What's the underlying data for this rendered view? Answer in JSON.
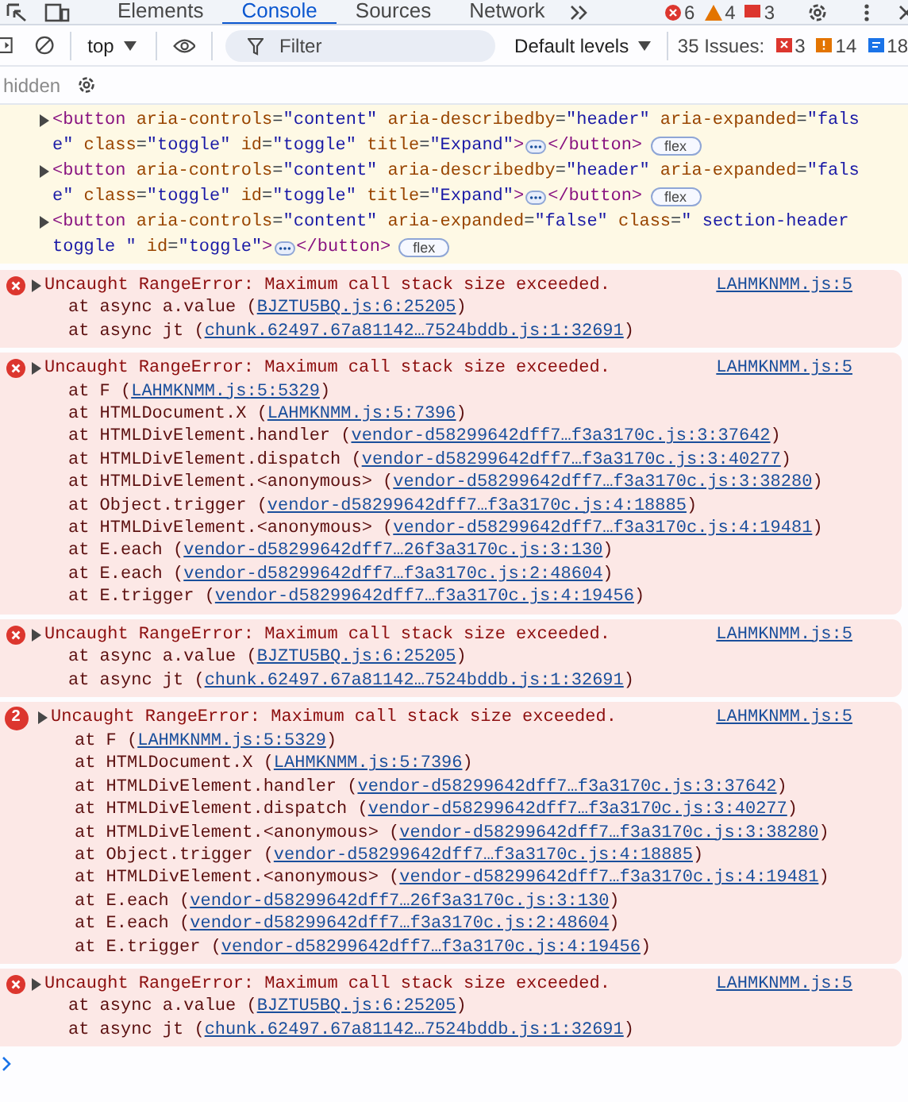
{
  "tabs": [
    {
      "label": "Elements",
      "selected": false
    },
    {
      "label": "Console",
      "selected": true
    },
    {
      "label": "Sources",
      "selected": false
    },
    {
      "label": "Network",
      "selected": false
    }
  ],
  "tab_counts": {
    "errors": "6",
    "warnings": "4",
    "issues": "3"
  },
  "toolbar": {
    "context": "top",
    "filter": {
      "placeholder": "Filter"
    },
    "levels": "Default levels",
    "issues_label": "35 Issues:",
    "issue_counts": [
      {
        "kind": "error",
        "count": "3"
      },
      {
        "kind": "warning",
        "count": "14"
      },
      {
        "kind": "info",
        "count": "18"
      }
    ]
  },
  "hidden_label": "hidden",
  "nodes": [
    {
      "expanded": false,
      "badge": "flex",
      "lines": [
        [
          {
            "kind": "tag",
            "text": "<button"
          },
          {
            "kind": "attr",
            "text": " aria-controls"
          },
          {
            "kind": "plain",
            "text": "="
          },
          {
            "kind": "value",
            "text": "\"content\""
          },
          {
            "kind": "attr",
            "text": " aria-describedby"
          },
          {
            "kind": "plain",
            "text": "="
          },
          {
            "kind": "value",
            "text": "\"header\""
          },
          {
            "kind": "attr",
            "text": " aria-expanded"
          },
          {
            "kind": "plain",
            "text": "="
          },
          {
            "kind": "value",
            "text": "\"fals"
          }
        ],
        [
          {
            "kind": "value",
            "text": "e\""
          },
          {
            "kind": "attr",
            "text": " class"
          },
          {
            "kind": "plain",
            "text": "="
          },
          {
            "kind": "value",
            "text": "\"toggle\""
          },
          {
            "kind": "attr",
            "text": " id"
          },
          {
            "kind": "plain",
            "text": "="
          },
          {
            "kind": "value",
            "text": "\"toggle\""
          },
          {
            "kind": "attr",
            "text": " title"
          },
          {
            "kind": "plain",
            "text": "="
          },
          {
            "kind": "value",
            "text": "\"Expand\""
          },
          {
            "kind": "tag",
            "text": ">"
          },
          {
            "kind": "ellipsis"
          },
          {
            "kind": "tag",
            "text": "</button>"
          }
        ]
      ]
    },
    {
      "expanded": false,
      "badge": "flex",
      "lines": [
        [
          {
            "kind": "tag",
            "text": "<button"
          },
          {
            "kind": "attr",
            "text": " aria-controls"
          },
          {
            "kind": "plain",
            "text": "="
          },
          {
            "kind": "value",
            "text": "\"content\""
          },
          {
            "kind": "attr",
            "text": " aria-describedby"
          },
          {
            "kind": "plain",
            "text": "="
          },
          {
            "kind": "value",
            "text": "\"header\""
          },
          {
            "kind": "attr",
            "text": " aria-expanded"
          },
          {
            "kind": "plain",
            "text": "="
          },
          {
            "kind": "value",
            "text": "\"fals"
          }
        ],
        [
          {
            "kind": "value",
            "text": "e\""
          },
          {
            "kind": "attr",
            "text": " class"
          },
          {
            "kind": "plain",
            "text": "="
          },
          {
            "kind": "value",
            "text": "\"toggle\""
          },
          {
            "kind": "attr",
            "text": " id"
          },
          {
            "kind": "plain",
            "text": "="
          },
          {
            "kind": "value",
            "text": "\"toggle\""
          },
          {
            "kind": "attr",
            "text": " title"
          },
          {
            "kind": "plain",
            "text": "="
          },
          {
            "kind": "value",
            "text": "\"Expand\""
          },
          {
            "kind": "tag",
            "text": ">"
          },
          {
            "kind": "ellipsis"
          },
          {
            "kind": "tag",
            "text": "</button>"
          }
        ]
      ]
    },
    {
      "expanded": false,
      "badge": "flex",
      "lines": [
        [
          {
            "kind": "tag",
            "text": "<button"
          },
          {
            "kind": "attr",
            "text": " aria-controls"
          },
          {
            "kind": "plain",
            "text": "="
          },
          {
            "kind": "value",
            "text": "\"content\""
          },
          {
            "kind": "attr",
            "text": " aria-expanded"
          },
          {
            "kind": "plain",
            "text": "="
          },
          {
            "kind": "value",
            "text": "\"false\""
          },
          {
            "kind": "attr",
            "text": " class"
          },
          {
            "kind": "plain",
            "text": "="
          },
          {
            "kind": "value",
            "text": "\" section-header"
          }
        ],
        [
          {
            "kind": "value",
            "text": "toggle \""
          },
          {
            "kind": "attr",
            "text": " id"
          },
          {
            "kind": "plain",
            "text": "="
          },
          {
            "kind": "value",
            "text": "\"toggle\""
          },
          {
            "kind": "tag",
            "text": ">"
          },
          {
            "kind": "ellipsis"
          },
          {
            "kind": "tag",
            "text": "</button>"
          }
        ]
      ]
    }
  ],
  "errors": [
    {
      "expanded": false,
      "message": "Uncaught RangeError: Maximum call stack size exceeded.",
      "source": "LAHMKNMM.js:5",
      "frames": [
        {
          "text": "at async a.value (",
          "link": "BJZTU5BQ.js:6:25205",
          "after": ")"
        },
        {
          "text": "at async jt (",
          "link": "chunk.62497.67a81142…7524bddb.js:1:32691",
          "after": ")"
        }
      ]
    },
    {
      "expanded": false,
      "message": "Uncaught RangeError: Maximum call stack size exceeded.",
      "source": "LAHMKNMM.js:5",
      "frames": [
        {
          "text": "at F (",
          "link": "LAHMKNMM.js:5:5329",
          "after": ")"
        },
        {
          "text": "at HTMLDocument.X (",
          "link": "LAHMKNMM.js:5:7396",
          "after": ")"
        },
        {
          "text": "at HTMLDivElement.handler (",
          "link": "vendor-d58299642dff7…f3a3170c.js:3:37642",
          "after": ")"
        },
        {
          "text": "at HTMLDivElement.dispatch (",
          "link": "vendor-d58299642dff7…f3a3170c.js:3:40277",
          "after": ")"
        },
        {
          "text": "at HTMLDivElement.<anonymous> (",
          "link": "vendor-d58299642dff7…f3a3170c.js:3:38280",
          "after": ")"
        },
        {
          "text": "at Object.trigger (",
          "link": "vendor-d58299642dff7…f3a3170c.js:4:18885",
          "after": ")"
        },
        {
          "text": "at HTMLDivElement.<anonymous> (",
          "link": "vendor-d58299642dff7…f3a3170c.js:4:19481",
          "after": ")"
        },
        {
          "text": "at E.each (",
          "link": "vendor-d58299642dff7…26f3a3170c.js:3:130",
          "after": ")"
        },
        {
          "text": "at E.each (",
          "link": "vendor-d58299642dff7…f3a3170c.js:2:48604",
          "after": ")"
        },
        {
          "text": "at E.trigger (",
          "link": "vendor-d58299642dff7…f3a3170c.js:4:19456",
          "after": ")"
        }
      ]
    },
    {
      "expanded": false,
      "message": "Uncaught RangeError: Maximum call stack size exceeded.",
      "source": "LAHMKNMM.js:5",
      "frames": [
        {
          "text": "at async a.value (",
          "link": "BJZTU5BQ.js:6:25205",
          "after": ")"
        },
        {
          "text": "at async jt (",
          "link": "chunk.62497.67a81142…7524bddb.js:1:32691",
          "after": ")"
        }
      ]
    },
    {
      "expanded": false,
      "count": "2",
      "message": "Uncaught RangeError: Maximum call stack size exceeded.",
      "source": "LAHMKNMM.js:5",
      "frames": [
        {
          "text": "at F (",
          "link": "LAHMKNMM.js:5:5329",
          "after": ")"
        },
        {
          "text": "at HTMLDocument.X (",
          "link": "LAHMKNMM.js:5:7396",
          "after": ")"
        },
        {
          "text": "at HTMLDivElement.handler (",
          "link": "vendor-d58299642dff7…f3a3170c.js:3:37642",
          "after": ")"
        },
        {
          "text": "at HTMLDivElement.dispatch (",
          "link": "vendor-d58299642dff7…f3a3170c.js:3:40277",
          "after": ")"
        },
        {
          "text": "at HTMLDivElement.<anonymous> (",
          "link": "vendor-d58299642dff7…f3a3170c.js:3:38280",
          "after": ")"
        },
        {
          "text": "at Object.trigger (",
          "link": "vendor-d58299642dff7…f3a3170c.js:4:18885",
          "after": ")"
        },
        {
          "text": "at HTMLDivElement.<anonymous> (",
          "link": "vendor-d58299642dff7…f3a3170c.js:4:19481",
          "after": ")"
        },
        {
          "text": "at E.each (",
          "link": "vendor-d58299642dff7…26f3a3170c.js:3:130",
          "after": ")"
        },
        {
          "text": "at E.each (",
          "link": "vendor-d58299642dff7…f3a3170c.js:2:48604",
          "after": ")"
        },
        {
          "text": "at E.trigger (",
          "link": "vendor-d58299642dff7…f3a3170c.js:4:19456",
          "after": ")"
        }
      ]
    },
    {
      "expanded": false,
      "message": "Uncaught RangeError: Maximum call stack size exceeded.",
      "source": "LAHMKNMM.js:5",
      "frames": [
        {
          "text": "at async a.value (",
          "link": "BJZTU5BQ.js:6:25205",
          "after": ")"
        },
        {
          "text": "at async jt (",
          "link": "chunk.62497.67a81142…7524bddb.js:1:32691",
          "after": ")"
        }
      ]
    }
  ]
}
